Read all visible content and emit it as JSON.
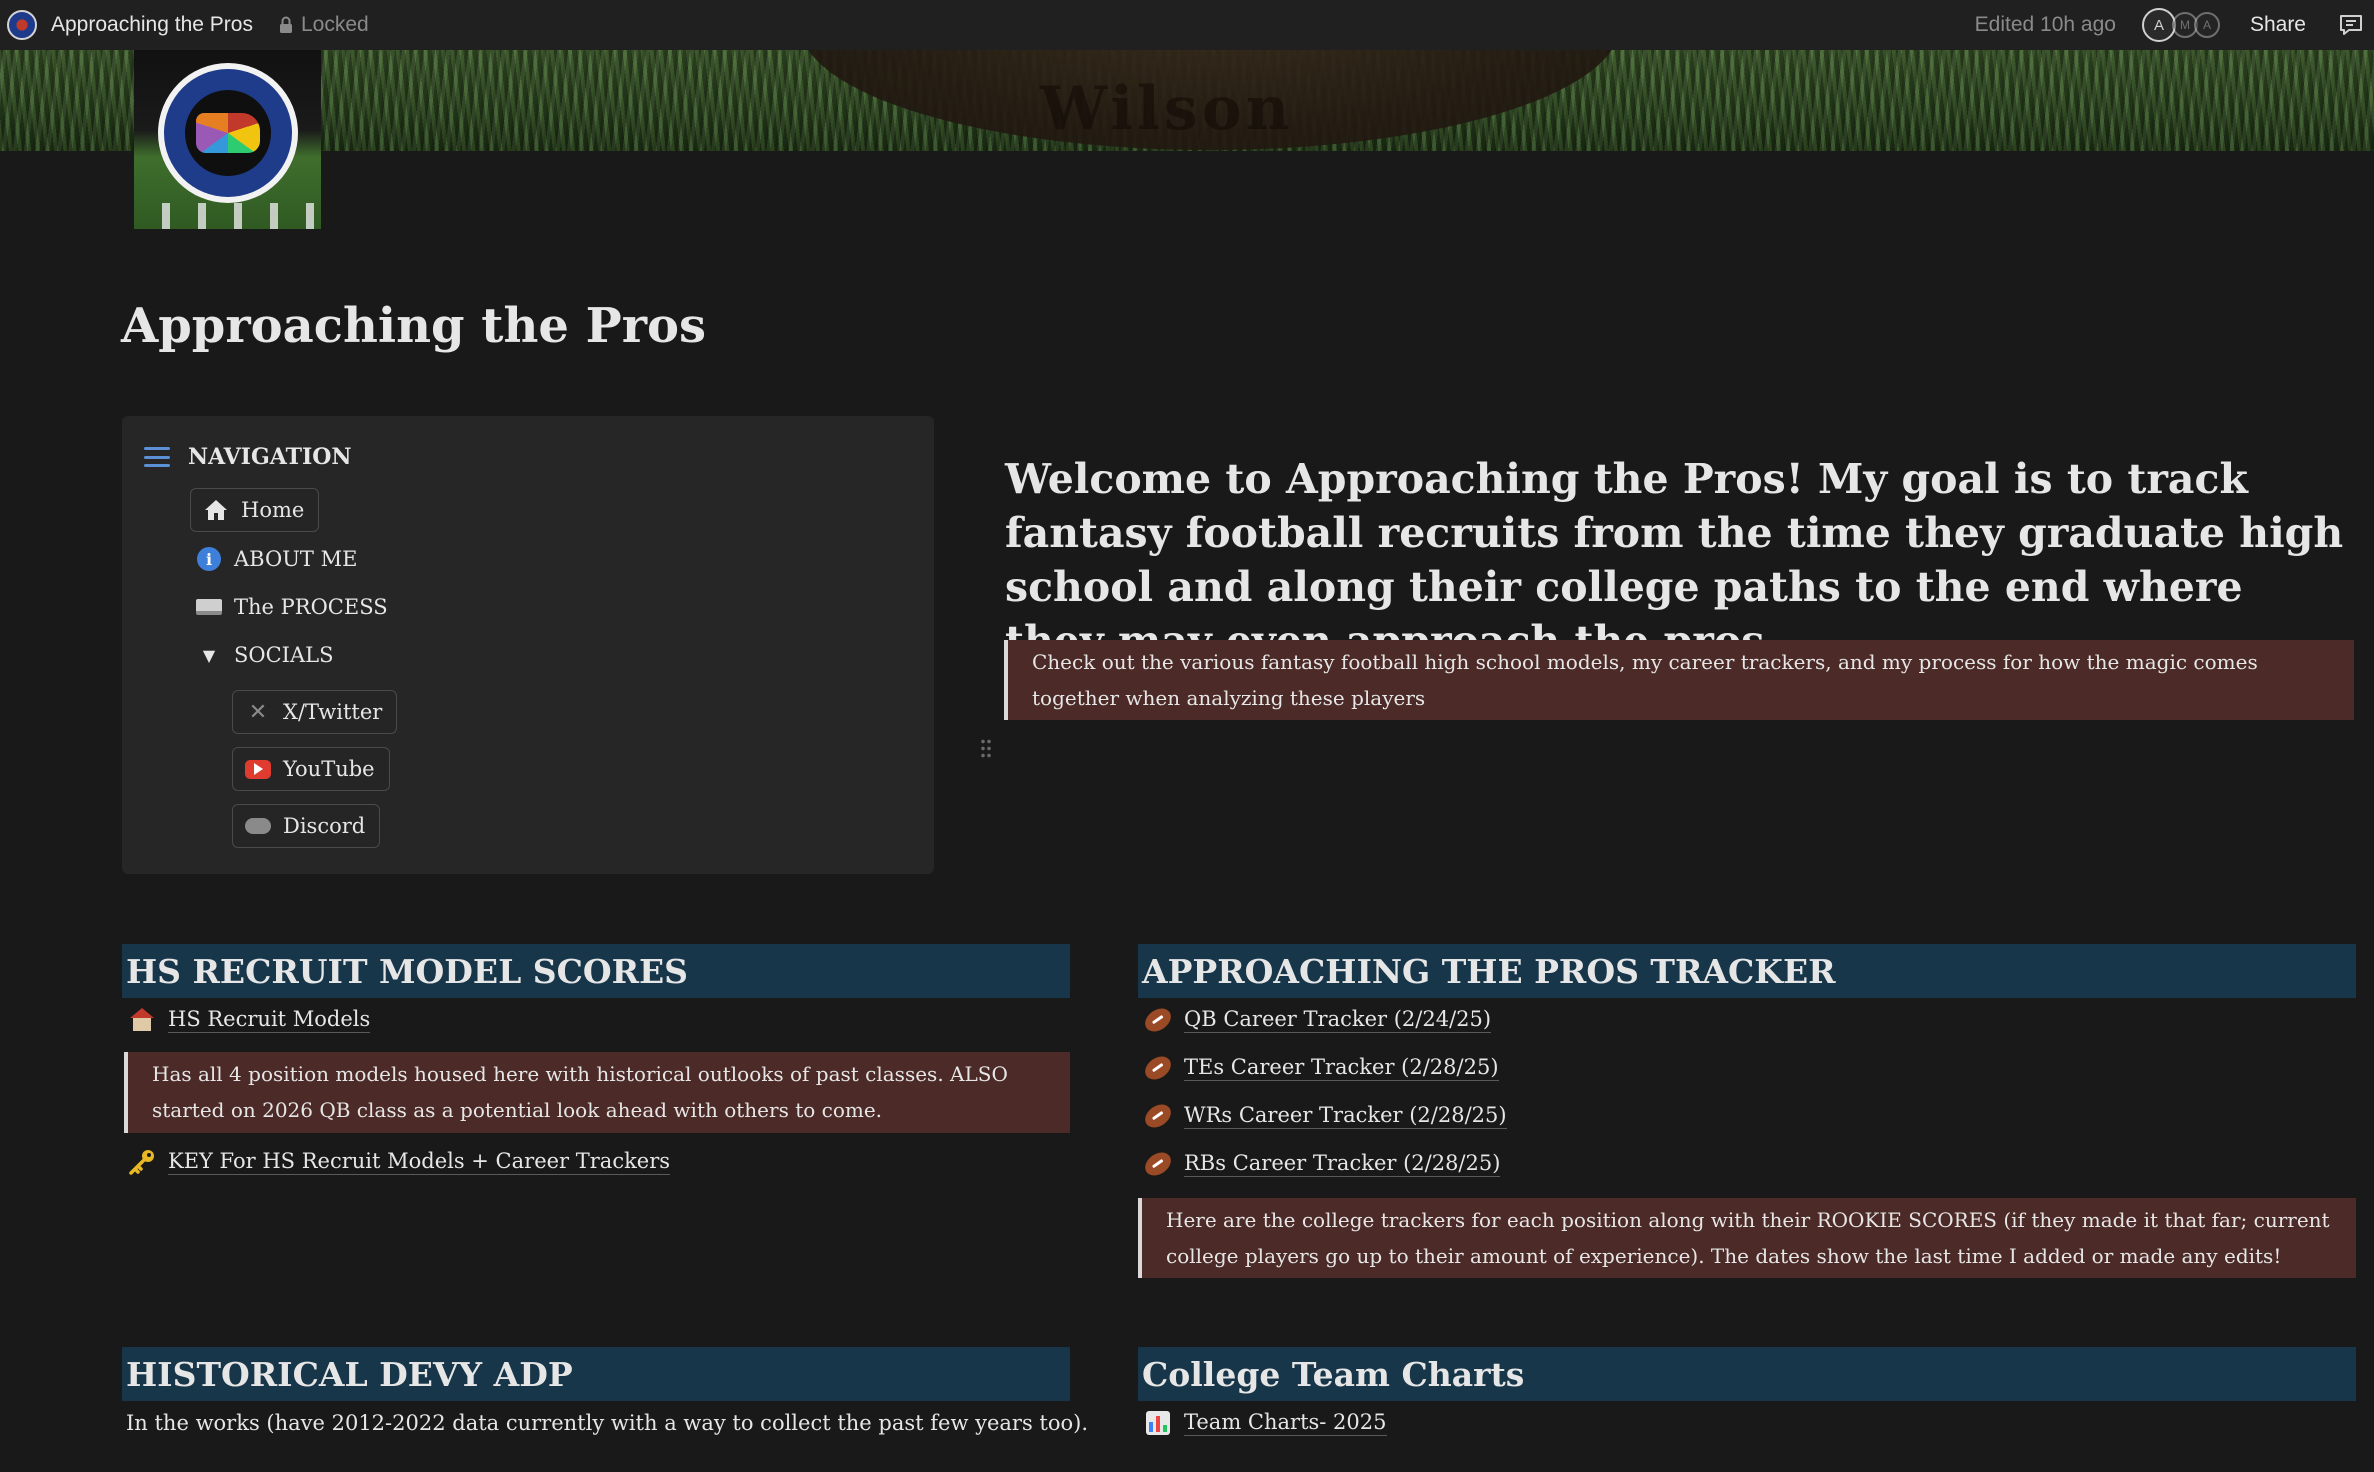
{
  "topbar": {
    "title": "Approaching the Pros",
    "lock_label": "Locked",
    "edited": "Edited 10h ago",
    "avatar_initial": "A",
    "avatar_initial_2": "M",
    "avatar_initial_3": "A",
    "share_label": "Share"
  },
  "cover": {
    "ball_text": "Wilson"
  },
  "page": {
    "title": "Approaching the Pros"
  },
  "navigation": {
    "heading": "NAVIGATION",
    "items": [
      {
        "label": "Home",
        "icon": "home-icon"
      },
      {
        "label": "ABOUT ME",
        "icon": "info-icon"
      },
      {
        "label": "The PROCESS",
        "icon": "keyboard-icon"
      },
      {
        "label": "SOCIALS",
        "icon": "toggle-caret-icon"
      }
    ],
    "socials": [
      {
        "label": "X/Twitter",
        "icon": "x-icon"
      },
      {
        "label": "YouTube",
        "icon": "youtube-icon"
      },
      {
        "label": "Discord",
        "icon": "gamepad-icon"
      }
    ]
  },
  "welcome": {
    "heading": "Welcome to Approaching the Pros! My goal is to track fantasy football recruits from the time they graduate high school and along their college paths to the end where they may even approach the pros.",
    "callout": "Check out the various fantasy football high school models, my career trackers, and my process for how the magic comes together when analyzing these players"
  },
  "hs_section": {
    "heading": "HS RECRUIT MODEL SCORES",
    "link": "HS Recruit Models",
    "callout": "Has all 4 position models housed here with historical outlooks of past classes. ALSO started on 2026 QB class as a potential look ahead with others to come.",
    "key_link": "KEY For HS Recruit Models + Career Trackers"
  },
  "tracker_section": {
    "heading": "APPROACHING THE PROS TRACKER",
    "links": [
      "QB Career Tracker (2/24/25)",
      "TEs Career Tracker (2/28/25)",
      "WRs Career Tracker (2/28/25)",
      "RBs Career Tracker (2/28/25)"
    ],
    "callout": "Here are the college trackers for each position along with their ROOKIE SCORES (if they made it that far; current college players go up to their amount of experience). The dates show the last time I added or made any edits!"
  },
  "devy_section": {
    "heading": "HISTORICAL DEVY ADP",
    "text": "In the works (have 2012-2022 data currently with a way to collect the past few years too)."
  },
  "team_section": {
    "heading": "College Team Charts",
    "link": "Team Charts- 2025"
  },
  "colors": {
    "background": "#191919",
    "topbar": "#202020",
    "panel": "#262626",
    "section_header": "#17364a",
    "callout": "#4b2a27",
    "accent_blue": "#5b8fd6"
  }
}
